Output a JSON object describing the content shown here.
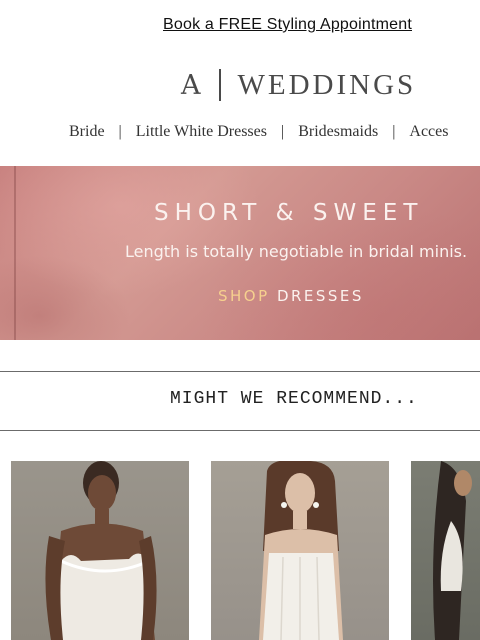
{
  "promo": {
    "link_text": "Book a FREE Styling Appointment"
  },
  "brand": {
    "logo_letter": "A",
    "logo_word": "WEDDINGS"
  },
  "nav": {
    "separator": "|",
    "items": [
      {
        "label": "Bride"
      },
      {
        "label": "Little White Dresses"
      },
      {
        "label": "Bridesmaids"
      },
      {
        "label": "Acces"
      }
    ]
  },
  "banner": {
    "title": "SHORT & SWEET",
    "subtitle": "Length is totally negotiable in bridal minis.",
    "cta_part1": "SHOP",
    "cta_part2": "DRESSES",
    "colors": {
      "background": "#c8817f",
      "cta_accent": "#f6d08e",
      "text": "#fbf2ef"
    }
  },
  "recommend": {
    "heading": "MIGHT WE RECOMMEND..."
  },
  "products": [
    {
      "image": "model-in-white-slip-dress"
    },
    {
      "image": "model-in-white-strapless-dress"
    },
    {
      "image": "model-in-white-dress-cropped"
    }
  ]
}
